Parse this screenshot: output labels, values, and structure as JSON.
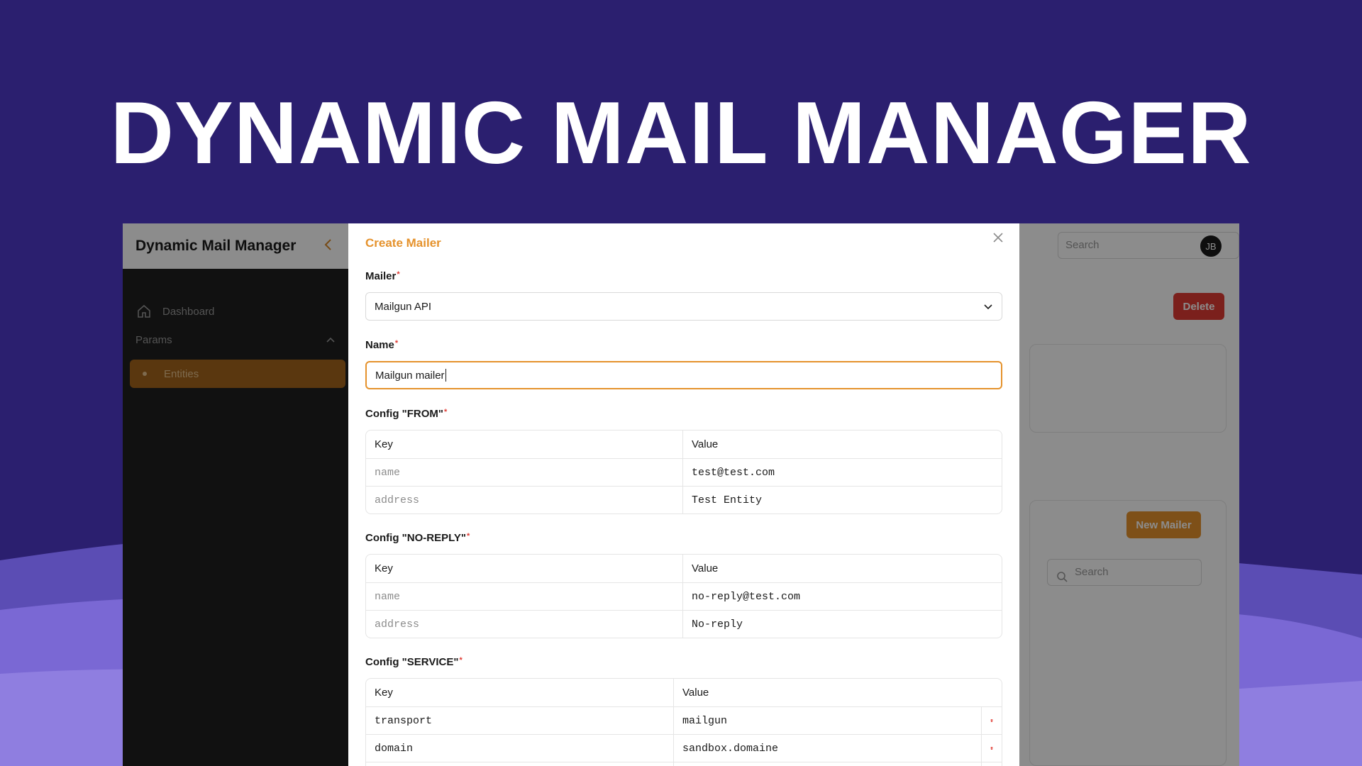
{
  "hero": {
    "title": "DYNAMIC MAIL MANAGER"
  },
  "colors": {
    "background": "#2b1f6f",
    "accent": "#e5922c",
    "danger": "#e03b34"
  },
  "sidebar": {
    "brand": "Dynamic Mail Manager",
    "collapse_icon": "chevron-left-icon",
    "items": [
      {
        "label": "Dashboard",
        "icon": "home-icon"
      },
      {
        "label": "Params",
        "icon": "chevron-up-icon"
      },
      {
        "label": "Entities",
        "active": true
      }
    ]
  },
  "topbar": {
    "search_placeholder": "Search",
    "avatar": "JB"
  },
  "main": {
    "delete_label": "Delete",
    "new_mailer_label": "New Mailer",
    "search_placeholder": "Search"
  },
  "modal": {
    "title": "Create Mailer",
    "close_icon": "close-icon",
    "mailer": {
      "label": "Mailer",
      "required": "*",
      "value": "Mailgun API"
    },
    "name": {
      "label": "Name",
      "required": "*",
      "value": "Mailgun mailer"
    },
    "config_from": {
      "label": "Config \"FROM\"",
      "required": "*",
      "header": {
        "key": "Key",
        "value": "Value"
      },
      "rows": [
        {
          "key": "name",
          "value": "test@test.com"
        },
        {
          "key": "address",
          "value": "Test Entity"
        }
      ]
    },
    "config_noreply": {
      "label": "Config \"NO-REPLY\"",
      "required": "*",
      "header": {
        "key": "Key",
        "value": "Value"
      },
      "rows": [
        {
          "key": "name",
          "value": "no-reply@test.com"
        },
        {
          "key": "address",
          "value": "No-reply"
        }
      ]
    },
    "config_service": {
      "label": "Config \"SERVICE\"",
      "required": "*",
      "header": {
        "key": "Key",
        "value": "Value"
      },
      "rows": [
        {
          "key": "transport",
          "value": "mailgun"
        },
        {
          "key": "domain",
          "value": "sandbox.domaine"
        }
      ]
    }
  }
}
